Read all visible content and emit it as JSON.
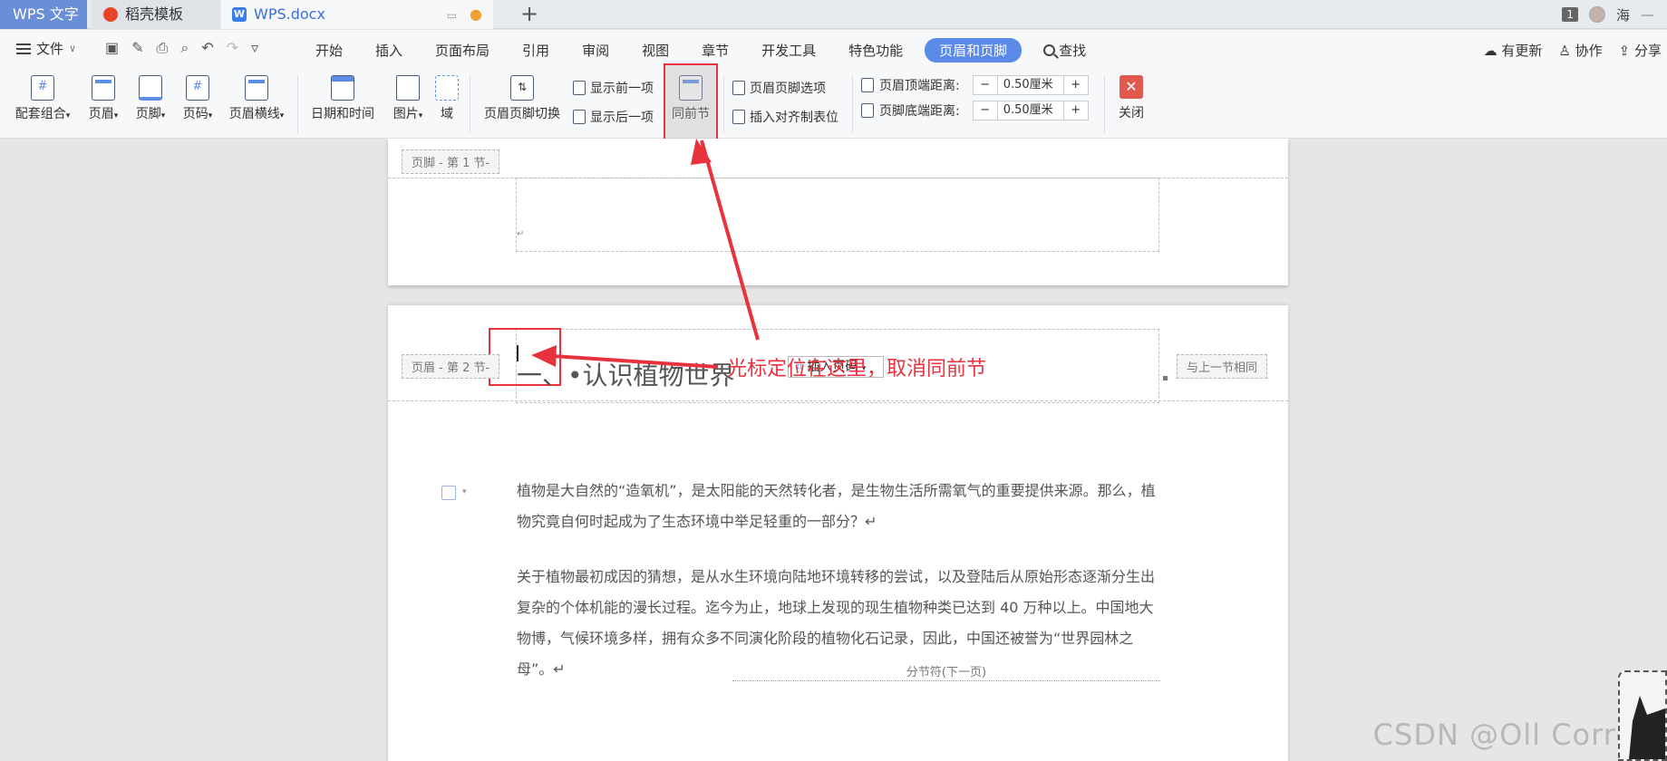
{
  "tabs": {
    "app": "WPS 文字",
    "daoke": "稻壳模板",
    "doc": "WPS.docx"
  },
  "titlebar_right": {
    "window_count": "1",
    "user": "海"
  },
  "menu": {
    "file": "文件",
    "items": [
      "开始",
      "插入",
      "页面布局",
      "引用",
      "审阅",
      "视图",
      "章节",
      "开发工具",
      "特色功能"
    ],
    "active": "页眉和页脚",
    "search": "查找",
    "update": "有更新",
    "collab": "协作",
    "share": "分享"
  },
  "ribbon": {
    "combo": "配套组合",
    "header": "页眉",
    "footer": "页脚",
    "pagenum": "页码",
    "header_line": "页眉横线",
    "datetime": "日期和时间",
    "picture": "图片",
    "field": "域",
    "switch": "页眉页脚切换",
    "show_prev": "显示前一项",
    "show_next": "显示后一项",
    "same_prev": "同前节",
    "hf_options": "页眉页脚选项",
    "insert_tab": "插入对齐制表位",
    "header_top": "页眉顶端距离:",
    "header_top_value": "0.50厘米",
    "footer_bottom": "页脚底端距离:",
    "footer_bottom_value": "0.50厘米",
    "close": "关闭",
    "minus": "−",
    "plus": "+"
  },
  "document": {
    "footer_tag": "页脚 - 第 1 节-",
    "header_tag": "页眉 - 第 2 节-",
    "same_as_prev_tag": "与上一节相同",
    "insert_page_number": "插入页码",
    "heading": "一、•认识植物世界",
    "para1": "植物是大自然的“造氧机”，是太阳能的天然转化者，是生物生活所需氧气的重要提供来源。那么，植物究竟自何时起成为了生态环境中举足轻重的一部分？↵",
    "para2": "关于植物最初成因的猜想，是从水生环境向陆地环境转移的尝试，以及登陆后从原始形态逐渐分生出复杂的个体机能的漫长过程。迄今为止，地球上发现的现生植物种类已达到 40 万种以上。中国地大物博，气候环境多样，拥有众多不同演化阶段的植物化石记录，因此，中国还被誉为“世界园林之母”。↵",
    "section_break": "分节符(下一页)"
  },
  "annotation": "光标定位在这里，取消同前节",
  "watermark": "CSDN @Oll Correct",
  "colors": {
    "accent": "#5b8ae8",
    "annotation_red": "#e8323c"
  }
}
